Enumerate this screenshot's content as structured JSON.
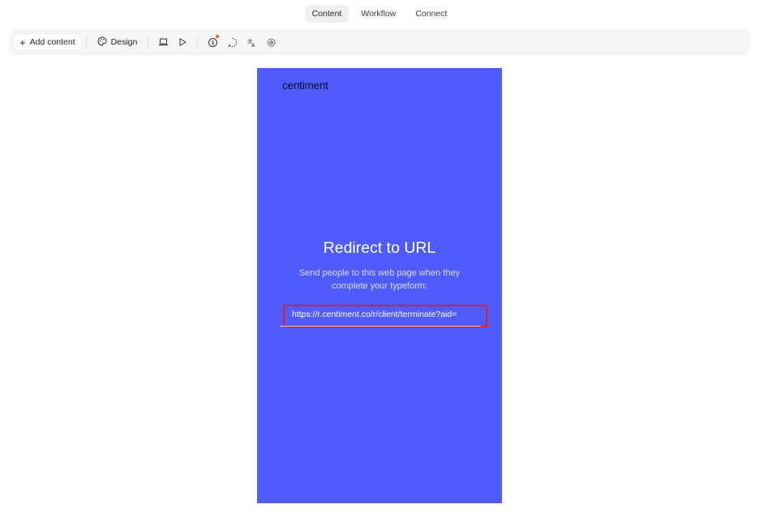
{
  "top_tabs": [
    {
      "label": "Content",
      "active": true
    },
    {
      "label": "Workflow",
      "active": false
    },
    {
      "label": "Connect",
      "active": false
    }
  ],
  "toolbar": {
    "add_content_label": "Add content",
    "design_label": "Design",
    "icons": [
      "laptop-icon",
      "play-icon",
      "currency-icon",
      "logic-icon",
      "translate-icon",
      "settings-icon"
    ]
  },
  "preview": {
    "background_color": "#4f5bfd",
    "logo_text": "centiment",
    "heading": "Redirect to URL",
    "description": "Send people to this web page when they complete your typeform:",
    "url_value": "https://r.centiment.co/r/client/terminate?aid="
  },
  "colors": {
    "highlight_border": "#e02020",
    "notification_dot": "#e0603a"
  }
}
